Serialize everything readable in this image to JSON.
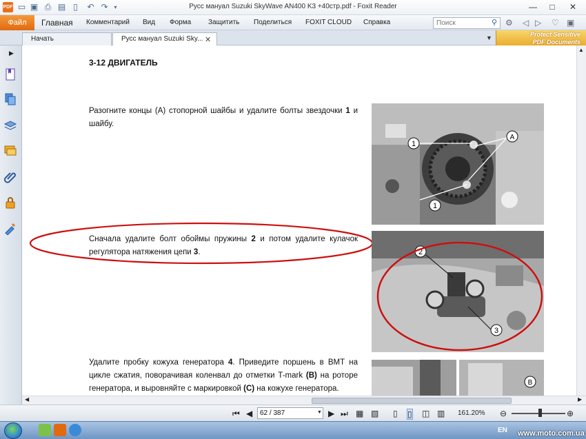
{
  "window": {
    "title": "Русс мануал Suzuki SkyWave AN400 K3 +40стр.pdf - Foxit Reader",
    "minimize": "—",
    "maximize": "□",
    "close": "✕"
  },
  "quick_access": {
    "app_icon": "PDF",
    "icons": [
      "folder-open-icon",
      "save-icon",
      "print-icon",
      "scan-icon",
      "new-icon",
      "undo-icon",
      "redo-icon",
      "customize-icon"
    ]
  },
  "ribbon": {
    "file": "Файл",
    "tabs": [
      "Главная",
      "Комментарий",
      "Вид",
      "Форма",
      "Защитить",
      "Поделиться",
      "FOXIT CLOUD",
      "Справка"
    ],
    "search_placeholder": "Поиск"
  },
  "doc_tabs": {
    "start": "Начать",
    "document": "Русс мануал Suzuki Sky...",
    "close": "✕"
  },
  "protect_banner": {
    "line1": "Protect Sensitive",
    "line2": "PDF Documents"
  },
  "sidebar": {
    "items": [
      "bookmarks-icon",
      "pages-icon",
      "layers-icon",
      "comments-icon",
      "attachments-icon",
      "security-icon",
      "signature-icon"
    ]
  },
  "page": {
    "heading": "3-12 ДВИГАТЕЛЬ",
    "para1": {
      "text": "Разогните концы (A) стопорной шайбы   и удалите болты звездочки ",
      "num": "1",
      "tail": " и шайбу."
    },
    "para2": {
      "pre": "Сначала удалите болт обоймы пружины ",
      "num1": "2",
      "mid": " и потом удалите кулачок регулятора натяжения цепи ",
      "num2": "3",
      "tail": "."
    },
    "para3": {
      "pre": "Удалите пробку кожуха генератора ",
      "num": "4",
      "mid": ". Приведите поршень в ВМТ на цикле сжатия, поворачивая коленвал до отметки T-mark ",
      "b1": "(B)",
      "mid2": " на роторе генератора, и выровняйте с маркировкой ",
      "c1": "(C)",
      "tail": " на кожухе генератора."
    },
    "photo1_labels": {
      "one": "1",
      "a": "A"
    },
    "photo2_labels": {
      "two": "2",
      "three": "3"
    },
    "photo3_labels": {
      "b": "B"
    }
  },
  "statusbar": {
    "page_value": "62 / 387",
    "zoom": "161.20%",
    "zoom_out": "⊖",
    "zoom_in": "⊕"
  },
  "taskbar": {
    "lang": "EN",
    "watermark": "www.moto.com.ua"
  },
  "colors": {
    "accent_orange": "#e06a10",
    "annotation_red": "#cc1010"
  }
}
